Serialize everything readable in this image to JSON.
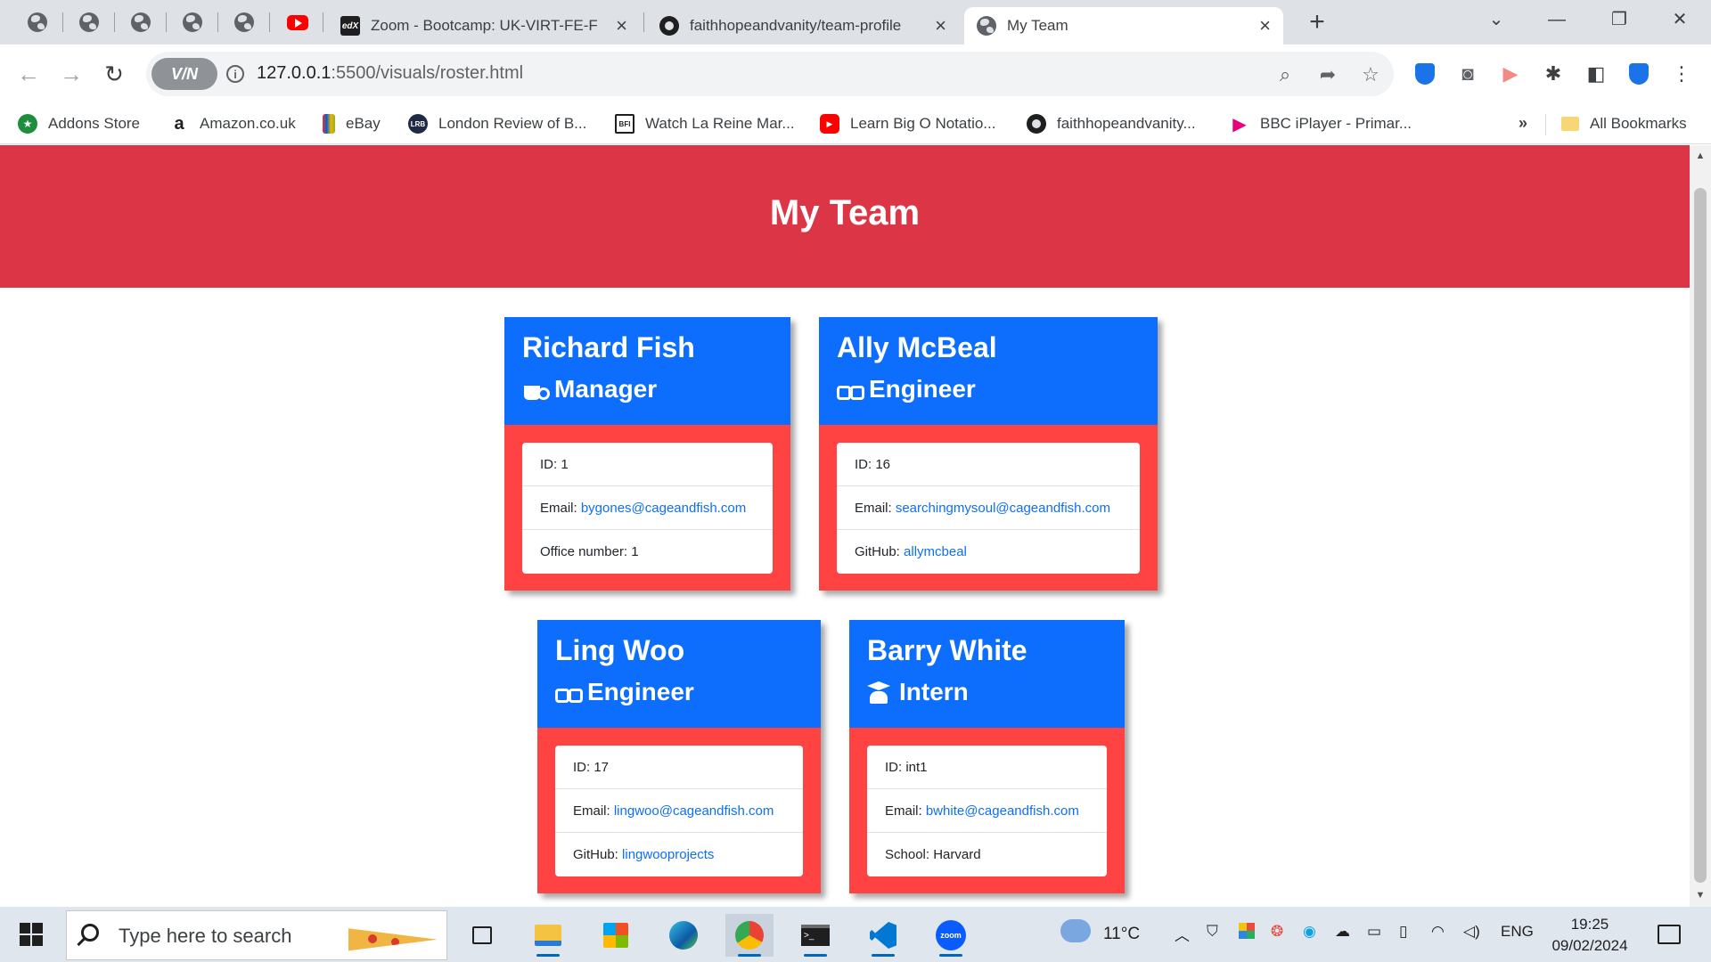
{
  "browser": {
    "tabs": [
      {
        "title": "Zoom - Bootcamp: UK-VIRT-FE-F",
        "icon": "edx-icon"
      },
      {
        "title": "faithhopeandvanity/team-profile",
        "icon": "github-icon"
      },
      {
        "title": "My Team",
        "icon": "globe-icon",
        "active": true
      }
    ],
    "address": {
      "vpn_label": "V/N",
      "host": "127.0.0.1",
      "path": ":5500/visuals/roster.html"
    },
    "bookmarks": [
      {
        "label": "Addons Store",
        "color": "#1e8e3e"
      },
      {
        "label": "Amazon.co.uk",
        "color": "#ffffff"
      },
      {
        "label": "eBay",
        "color": "#e53238"
      },
      {
        "label": "London Review of B...",
        "color": "#1f2a44"
      },
      {
        "label": "Watch La Reine Mar...",
        "color": "#ffffff"
      },
      {
        "label": "Learn Big O Notatio...",
        "color": "#ff0000"
      },
      {
        "label": "faithhopeandvanity...",
        "color": "#1f1f1f"
      },
      {
        "label": "BBC iPlayer - Primar...",
        "color": "#e6007e"
      }
    ],
    "bookmarks_more": "»",
    "all_bookmarks": "All Bookmarks",
    "new_tab_symbol": "+"
  },
  "page": {
    "title": "My Team",
    "accent_header": "#dc3545",
    "card_header_color": "#0d6efd",
    "card_body_color": "#ff4343",
    "employees": [
      {
        "name": "Richard Fish",
        "role": "Manager",
        "role_icon": "mug-icon",
        "id_label": "ID: ",
        "id": "1",
        "email_label": "Email: ",
        "email": "bygones@cageandfish.com",
        "extra_label": "Office number: ",
        "extra": "1"
      },
      {
        "name": "Ally McBeal",
        "role": "Engineer",
        "role_icon": "glasses-icon",
        "id_label": "ID: ",
        "id": "16",
        "email_label": "Email: ",
        "email": "searchingmysoul@cageandfish.com",
        "extra_label": "GitHub: ",
        "extra": "allymcbeal"
      },
      {
        "name": "Ling Woo",
        "role": "Engineer",
        "role_icon": "glasses-icon",
        "id_label": "ID: ",
        "id": "17",
        "email_label": "Email: ",
        "email": "lingwoo@cageandfish.com",
        "extra_label": "GitHub: ",
        "extra": "lingwooprojects"
      },
      {
        "name": "Barry White",
        "role": "Intern",
        "role_icon": "graduate-icon",
        "id_label": "ID: ",
        "id": "int1",
        "email_label": "Email: ",
        "email": "bwhite@cageandfish.com",
        "extra_label": "School: ",
        "extra": "Harvard"
      }
    ]
  },
  "taskbar": {
    "search_placeholder": "Type here to search",
    "weather": "11°C",
    "language": "ENG",
    "time": "19:25",
    "date": "09/02/2024"
  }
}
